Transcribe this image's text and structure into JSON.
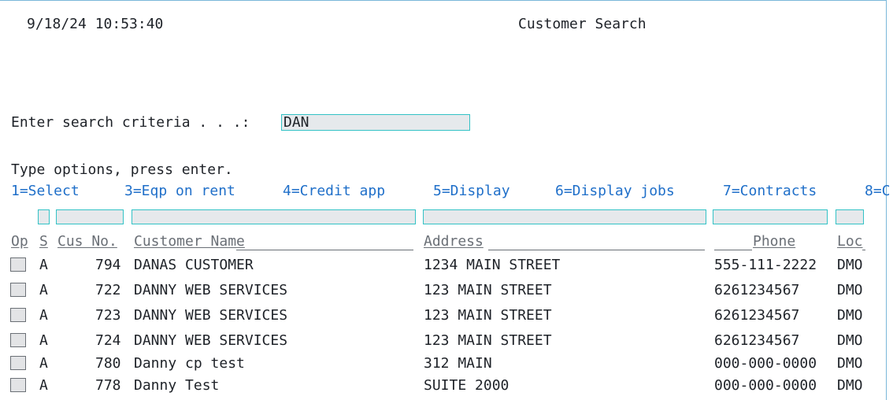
{
  "header": {
    "timestamp": "9/18/24 10:53:40",
    "title": "Customer Search"
  },
  "search": {
    "label": "Enter search criteria . . .:",
    "value": "DAN"
  },
  "options": {
    "instruction": "Type options, press enter.",
    "items": [
      "1=Select",
      "3=Eqp on rent",
      "4=Credit app",
      "5=Display",
      "6=Display jobs",
      "7=Contracts",
      "8=C"
    ]
  },
  "table": {
    "columns": {
      "op": "Op",
      "status": "S",
      "cust_no": "Cus No.",
      "name": "Customer Name",
      "address": "Address",
      "phone": "Phone",
      "loc": "Loc"
    },
    "rows": [
      {
        "status": "A",
        "cust_no": "794",
        "name": "DANAS CUSTOMER",
        "address": "1234 MAIN STREET",
        "phone": "555-111-2222",
        "loc": "DMO"
      },
      {
        "status": "A",
        "cust_no": "722",
        "name": "DANNY WEB SERVICES",
        "address": "123 MAIN STREET",
        "phone": "6261234567",
        "loc": "DMO"
      },
      {
        "status": "A",
        "cust_no": "723",
        "name": "DANNY WEB SERVICES",
        "address": "123 MAIN STREET",
        "phone": "6261234567",
        "loc": "DMO"
      },
      {
        "status": "A",
        "cust_no": "724",
        "name": "DANNY WEB SERVICES",
        "address": "123 MAIN STREET",
        "phone": "6261234567",
        "loc": "DMO"
      },
      {
        "status": "A",
        "cust_no": "780",
        "name": "Danny cp test",
        "address": "312 MAIN",
        "phone": "000-000-0000",
        "loc": "DMO"
      },
      {
        "status": "A",
        "cust_no": "778",
        "name": "Danny Test",
        "address": "SUITE 2000",
        "phone": "000-000-0000",
        "loc": "DMO"
      }
    ]
  },
  "colors": {
    "option_text": "#1f6fc9",
    "field_border": "#33c2c6",
    "field_fill": "#e6e9ec",
    "frame": "#7ab7d9"
  }
}
